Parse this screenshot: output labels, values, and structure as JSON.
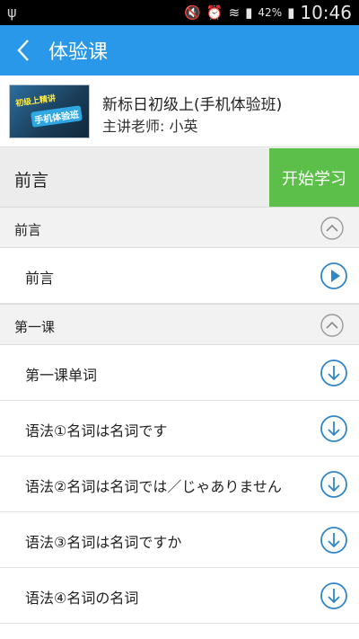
{
  "status_bar": {
    "usb_icon": "usb-icon",
    "battery_percent": "42%",
    "time": "10:46"
  },
  "app_bar": {
    "title": "体验课"
  },
  "course": {
    "thumbnail_text_1": "初级上精讲",
    "thumbnail_text_2": "手机体验班",
    "title": "新标日初级上(手机体验班)",
    "teacher": "主讲老师: 小英"
  },
  "section": {
    "title": "前言",
    "start_label": "开始学习"
  },
  "chapters": [
    {
      "label": "前言",
      "items": [
        {
          "label": "前言",
          "icon": "play-icon"
        }
      ]
    },
    {
      "label": "第一课",
      "items": [
        {
          "label": "第一课单词",
          "icon": "download-icon"
        },
        {
          "label": "语法①名词は名词です",
          "icon": "download-icon"
        },
        {
          "label": "语法②名词は名词では／じゃありません",
          "icon": "download-icon"
        },
        {
          "label": "语法③名词は名词ですか",
          "icon": "download-icon"
        },
        {
          "label": "语法④名词の名词",
          "icon": "download-icon"
        }
      ]
    }
  ],
  "colors": {
    "accent": "#2a98e8",
    "start": "#5cbf4a",
    "icon": "#2f86c8"
  }
}
